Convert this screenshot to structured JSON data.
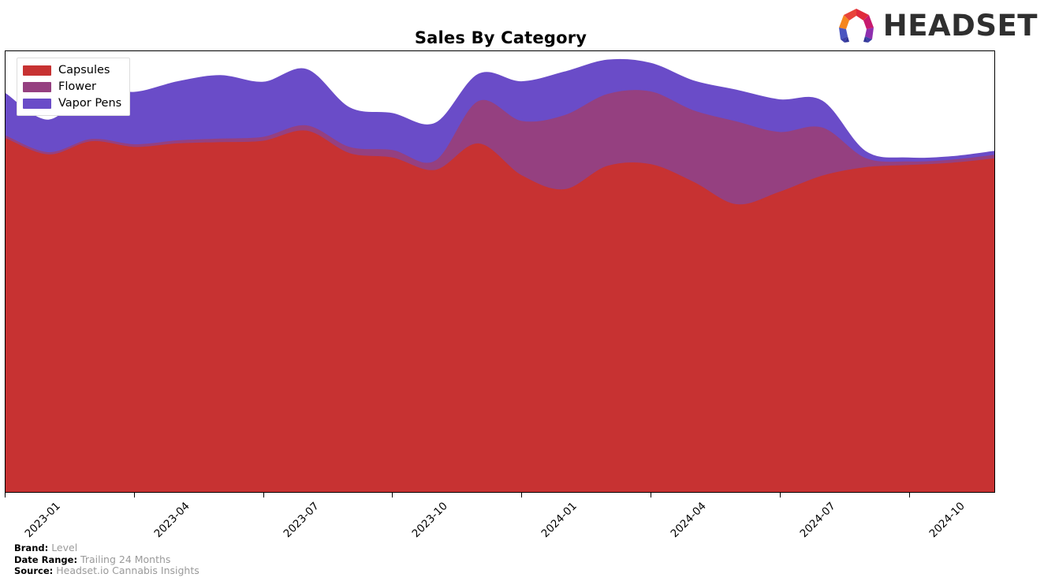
{
  "header": {
    "title": "Sales By Category",
    "logo_word": "HEADSET",
    "logo_mark_name": "headset-logo-mark"
  },
  "legend": {
    "position": "upper-left",
    "items": [
      {
        "label": "Capsules",
        "color": "#c73232"
      },
      {
        "label": "Flower",
        "color": "#954080"
      },
      {
        "label": "Vapor Pens",
        "color": "#6a4cc8"
      }
    ]
  },
  "footer": {
    "rows": [
      {
        "key": "Brand:",
        "value": "Level"
      },
      {
        "key": "Date Range:",
        "value": "Trailing 24 Months"
      },
      {
        "key": "Source:",
        "value": "Headset.io Cannabis Insights"
      }
    ]
  },
  "chart_data": {
    "type": "area",
    "stacked": true,
    "title": "Sales By Category",
    "xlabel": "",
    "ylabel": "",
    "grid": false,
    "legend_position": "upper-left",
    "axis": {
      "y_visible": false,
      "x_tick_rotation": -45,
      "ylim": [
        0,
        100
      ]
    },
    "x": [
      "2023-01",
      "2023-02",
      "2023-03",
      "2023-04",
      "2023-05",
      "2023-06",
      "2023-07",
      "2023-08",
      "2023-09",
      "2023-10",
      "2023-11",
      "2023-12",
      "2024-01",
      "2024-02",
      "2024-03",
      "2024-04",
      "2024-05",
      "2024-06",
      "2024-07",
      "2024-08",
      "2024-09",
      "2024-10",
      "2024-11",
      "2024-12"
    ],
    "x_tick_labels": [
      "2023-01",
      "2023-04",
      "2023-07",
      "2023-10",
      "2024-01",
      "2024-04",
      "2024-07",
      "2024-10"
    ],
    "x_tick_indices": [
      0,
      3,
      6,
      9,
      12,
      15,
      18,
      21
    ],
    "series": [
      {
        "name": "Capsules",
        "color": "#c73232",
        "values": [
          80.2,
          76.5,
          79.5,
          78.2,
          79.0,
          79.3,
          79.6,
          81.9,
          76.8,
          75.8,
          73.0,
          79.0,
          71.8,
          68.6,
          73.9,
          74.3,
          70.3,
          65.2,
          68.0,
          71.7,
          73.6,
          74.1,
          74.6,
          75.6
        ]
      },
      {
        "name": "Flower",
        "color": "#954080",
        "values": [
          0.6,
          0.5,
          0.5,
          0.6,
          0.7,
          0.8,
          0.9,
          1.2,
          1.4,
          1.7,
          2.1,
          9.6,
          12.3,
          16.8,
          16.3,
          16.5,
          16.2,
          18.8,
          13.6,
          10.9,
          2.1,
          0.8,
          0.7,
          0.8
        ]
      },
      {
        "name": "Vapor Pens",
        "color": "#6a4cc8",
        "values": [
          9.6,
          7.4,
          11.5,
          11.9,
          13.4,
          14.4,
          12.5,
          12.8,
          9.0,
          8.4,
          8.6,
          6.2,
          9.0,
          9.9,
          7.8,
          6.5,
          6.8,
          7.2,
          7.4,
          6.1,
          1.6,
          0.9,
          0.8,
          0.9
        ]
      }
    ]
  }
}
